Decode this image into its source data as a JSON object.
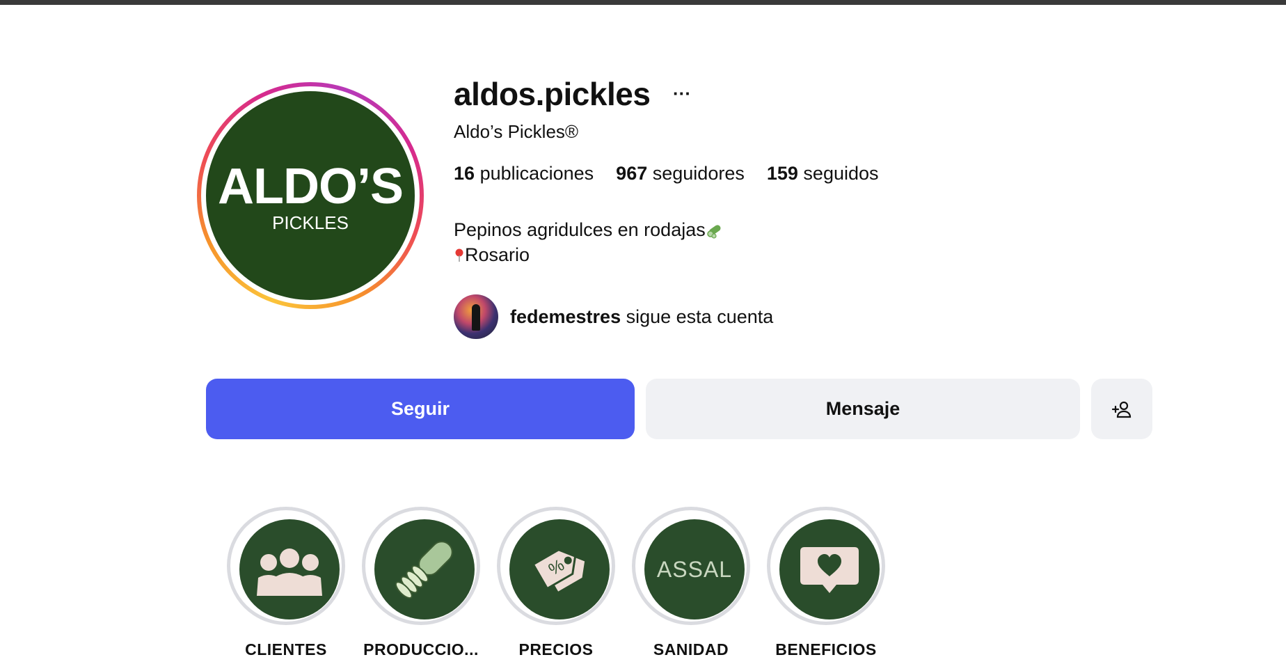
{
  "profile": {
    "username": "aldos.pickles",
    "full_name": "Aldo’s Pickles®",
    "avatar_logo": {
      "main": "ALDO’S",
      "sub": "PICKLES"
    },
    "stats": [
      {
        "count": "16",
        "label": "publicaciones"
      },
      {
        "count": "967",
        "label": "seguidores"
      },
      {
        "count": "159",
        "label": "seguidos"
      }
    ],
    "bio": {
      "line1": "Pepinos agridulces en rodajas",
      "line2": "Rosario"
    },
    "followed_by": {
      "username": "fedemestres",
      "text": "sigue esta cuenta"
    }
  },
  "actions": {
    "follow_label": "Seguir",
    "message_label": "Mensaje"
  },
  "highlights": [
    {
      "label": "CLIENTES",
      "icon": "people-icon"
    },
    {
      "label": "PRODUCCIO...",
      "icon": "sliced-cucumber-icon"
    },
    {
      "label": "PRECIOS",
      "icon": "price-tag-icon"
    },
    {
      "label": "SANIDAD",
      "icon": "assal-logo",
      "text": "ASSAL"
    },
    {
      "label": "BENEFICIOS",
      "icon": "heart-message-icon"
    }
  ],
  "colors": {
    "follow_button": "#4c5cf0",
    "secondary_button": "#f0f1f4",
    "highlight_bg": "#2a4d2b",
    "avatar_bg": "#22481a"
  }
}
